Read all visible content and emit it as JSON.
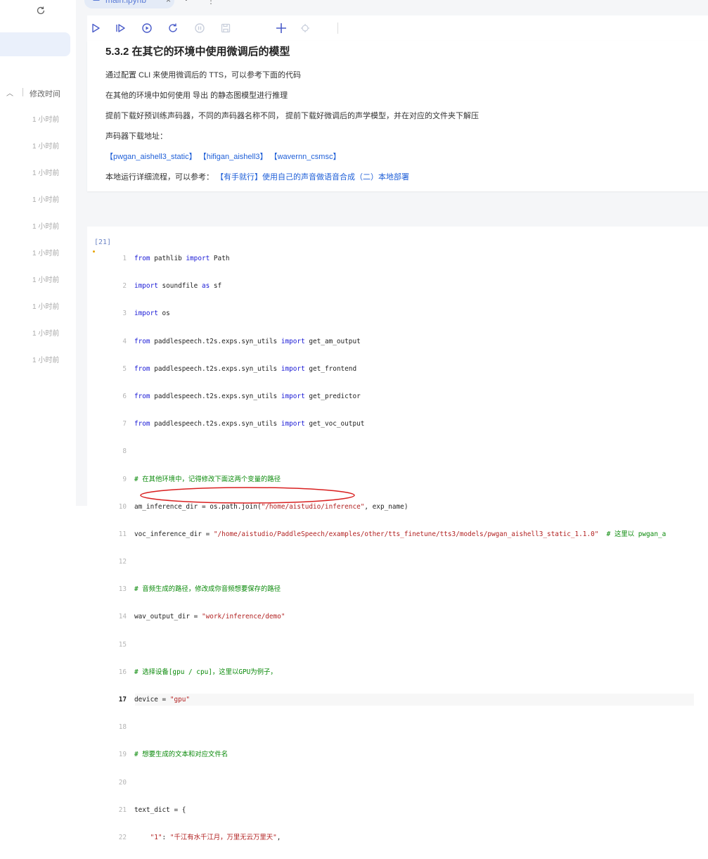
{
  "sidebar": {
    "sort_column": "修改时间",
    "times": [
      "1 小时前",
      "1 小时前",
      "1 小时前",
      "1 小时前",
      "1 小时前",
      "1 小时前",
      "1 小时前",
      "1 小时前",
      "1 小时前",
      "1 小时前"
    ]
  },
  "tabs": [
    {
      "label": "main.ipynb"
    }
  ],
  "markdown": {
    "heading": "5.3.2 在其它的环境中使用微调后的模型",
    "p1": "通过配置 CLI 来使用微调后的 TTS，可以参考下面的代码",
    "p2": "在其他的环境中如何使用 导出 的静态图模型进行推理",
    "p3": "提前下载好预训练声码器，不同的声码器名称不同， 提前下载好微调后的声学模型，并在对应的文件夹下解压",
    "p4": "声码器下载地址：",
    "links": [
      "【pwgan_aishell3_static】",
      "【hifigan_aishell3】",
      "【wavernn_csmsc】"
    ],
    "p6_prefix": "本地运行详细流程，可以参考：",
    "p6_link": "【有手就行】使用自己的声音做语音合成（二）本地部署"
  },
  "code_cell": {
    "prompt": "[21]",
    "lines": {
      "l1": [
        "1",
        "from",
        " pathlib ",
        "import",
        " Path"
      ],
      "l2": [
        "2",
        "import",
        " soundfile ",
        "as",
        " sf"
      ],
      "l3": [
        "3",
        "import",
        " os"
      ],
      "l4": [
        "4",
        "from",
        " paddlespeech.t2s.exps.syn_utils ",
        "import",
        " get_am_output"
      ],
      "l5": [
        "5",
        "from",
        " paddlespeech.t2s.exps.syn_utils ",
        "import",
        " get_frontend"
      ],
      "l6": [
        "6",
        "from",
        " paddlespeech.t2s.exps.syn_utils ",
        "import",
        " get_predictor"
      ],
      "l7": [
        "7",
        "from",
        " paddlespeech.t2s.exps.syn_utils ",
        "import",
        " get_voc_output"
      ],
      "l8": [
        "8"
      ],
      "l9": [
        "9",
        "# 在其他环境中，记得修改下面这两个变量的路径"
      ],
      "l10": [
        "10",
        "am_inference_dir = os.path.join(",
        "\"/home/aistudio/inference\"",
        ", exp_name)"
      ],
      "l11": [
        "11",
        "voc_inference_dir = ",
        "\"/home/aistudio/PaddleSpeech/examples/other/tts_finetune/tts3/models/pwgan_aishell3_static_1.1.0\"",
        "  # 这里以 pwgan_a"
      ],
      "l12": [
        "12"
      ],
      "l13": [
        "13",
        "# 音频生成的路径，修改成你音频想要保存的路径"
      ],
      "l14": [
        "14",
        "wav_output_dir = ",
        "\"work/inference/demo\""
      ],
      "l15": [
        "15"
      ],
      "l16": [
        "16",
        "# 选择设备[gpu / cpu]，这里以GPU为例子，"
      ],
      "l17": [
        "17",
        "device = ",
        "\"gpu\""
      ],
      "l18": [
        "18"
      ],
      "l19": [
        "19",
        "# 想要生成的文本和对应文件名"
      ],
      "l20": [
        "20"
      ],
      "l21": [
        "21",
        "text_dict = {"
      ],
      "l22": [
        "22",
        "    ",
        "\"1\"",
        ": ",
        "\"千江有水千江月，万里无云万里天\"",
        ","
      ]
    }
  },
  "colors": {
    "accent": "#2060d8",
    "keyword": "#1a1ad6",
    "string": "#b22222",
    "comment": "#0a8a0a",
    "annotation": "#d92020"
  },
  "icons": [
    "refresh-icon",
    "run-icon",
    "run-all-icon",
    "run-reset-icon",
    "restart-icon",
    "interrupt-icon",
    "save-icon",
    "add-cell-icon",
    "target-icon",
    "notebook-icon"
  ]
}
